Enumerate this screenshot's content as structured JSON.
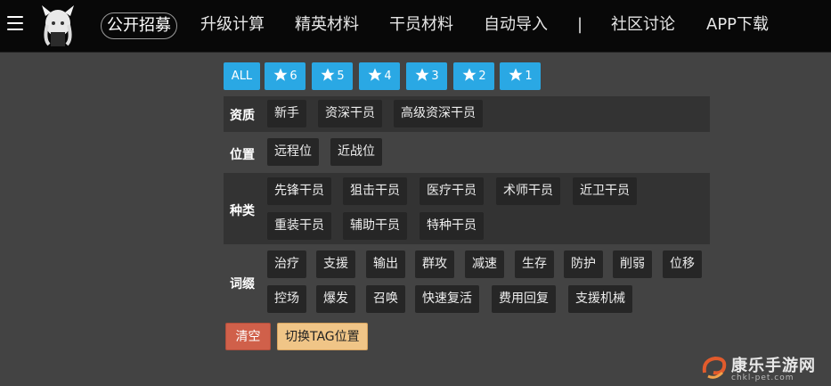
{
  "nav": {
    "items": [
      "公开招募",
      "升级计算",
      "精英材料",
      "干员材料",
      "自动导入",
      "|",
      "社区讨论",
      "APP下载"
    ]
  },
  "stars": {
    "all_label": "ALL",
    "levels": [
      "6",
      "5",
      "4",
      "3",
      "2",
      "1"
    ]
  },
  "rows": {
    "qualification": {
      "label": "资质",
      "tags": [
        "新手",
        "资深干员",
        "高级资深干员"
      ]
    },
    "position": {
      "label": "位置",
      "tags": [
        "远程位",
        "近战位"
      ]
    },
    "class": {
      "label": "种类",
      "tags": [
        "先锋干员",
        "狙击干员",
        "医疗干员",
        "术师干员",
        "近卫干员",
        "重装干员",
        "辅助干员",
        "特种干员"
      ]
    },
    "affix": {
      "label": "词缀",
      "tags": [
        "治疗",
        "支援",
        "输出",
        "群攻",
        "减速",
        "生存",
        "防护",
        "削弱",
        "位移",
        "控场",
        "爆发",
        "召唤",
        "快速复活",
        "费用回复",
        "支援机械"
      ]
    }
  },
  "actions": {
    "clear_label": "清空",
    "switch_label": "切换TAG位置"
  },
  "watermark": {
    "title": "康乐手游网",
    "subtitle": "chkl-pet.com"
  },
  "colors": {
    "star_blue": "#2aa8e4",
    "clear_red": "#d0604a",
    "switch_tan": "#f0c587"
  }
}
